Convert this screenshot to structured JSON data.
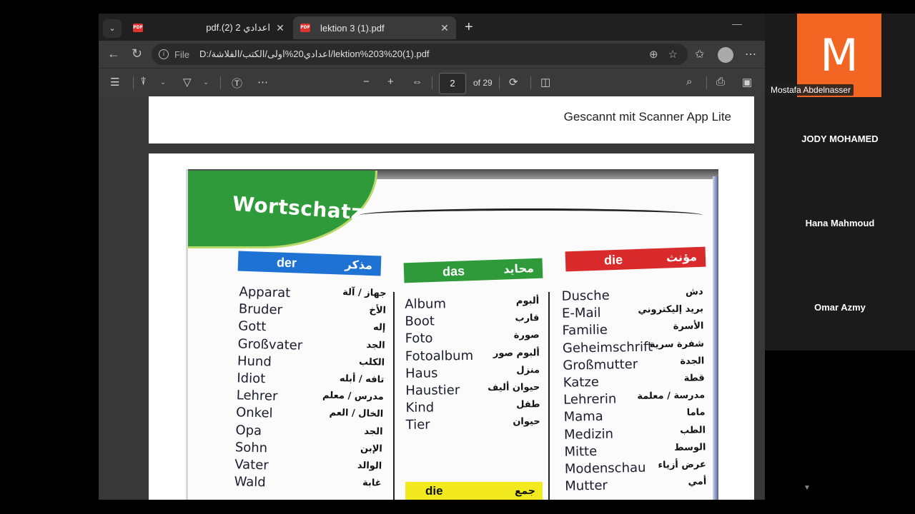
{
  "browser": {
    "tabs": [
      {
        "title": "pdf.(2) 2 اعدادي",
        "active": false
      },
      {
        "title": "lektion 3 (1).pdf",
        "active": true
      }
    ],
    "address": {
      "scheme": "File",
      "url": "D:/اعدادي20%اولى/الكتب/الفلاشة/lektion%203%20(1).pdf"
    },
    "pdf_toolbar": {
      "current_page": "2",
      "page_count": "of 29"
    }
  },
  "document": {
    "page1_stamp": "Gescannt mit Scanner App Lite",
    "page2": {
      "title": "Wortschatz",
      "columns": [
        {
          "article": "der",
          "article_ar": "مذكر",
          "color": "#1e72d4",
          "words": [
            {
              "de": "Apparat",
              "ar": "جهاز / آلة"
            },
            {
              "de": "Bruder",
              "ar": "الأخ"
            },
            {
              "de": "Gott",
              "ar": "إله"
            },
            {
              "de": "Großvater",
              "ar": "الجد"
            },
            {
              "de": "Hund",
              "ar": "الكلب"
            },
            {
              "de": "Idiot",
              "ar": "تافه / أبله"
            },
            {
              "de": "Lehrer",
              "ar": "مدرس / معلم"
            },
            {
              "de": "Onkel",
              "ar": "الخال / العم"
            },
            {
              "de": "Opa",
              "ar": "الجد"
            },
            {
              "de": "Sohn",
              "ar": "الإبن"
            },
            {
              "de": "Vater",
              "ar": "الوالد"
            },
            {
              "de": "Wald",
              "ar": "غابة"
            }
          ]
        },
        {
          "article": "das",
          "article_ar": "محايد",
          "color": "#2f9a3a",
          "words": [
            {
              "de": "Album",
              "ar": "ألبوم"
            },
            {
              "de": "Boot",
              "ar": "قارب"
            },
            {
              "de": "Foto",
              "ar": "صورة"
            },
            {
              "de": "Fotoalbum",
              "ar": "ألبوم صور"
            },
            {
              "de": "Haus",
              "ar": "منزل"
            },
            {
              "de": "Haustier",
              "ar": "حيوان أليف"
            },
            {
              "de": "Kind",
              "ar": "طفل"
            },
            {
              "de": "Tier",
              "ar": "حيوان"
            }
          ]
        },
        {
          "article": "die",
          "article_ar": "مؤنث",
          "color": "#d92b2b",
          "words": [
            {
              "de": "Dusche",
              "ar": "دش"
            },
            {
              "de": "E-Mail",
              "ar": "بريد إليكتروني"
            },
            {
              "de": "Familie",
              "ar": "الأسرة"
            },
            {
              "de": "Geheimschrift",
              "ar": "شفرة سرية"
            },
            {
              "de": "Großmutter",
              "ar": "الجدة"
            },
            {
              "de": "Katze",
              "ar": "قطة"
            },
            {
              "de": "Lehrerin",
              "ar": "مدرسة / معلمة"
            },
            {
              "de": "Mama",
              "ar": "ماما"
            },
            {
              "de": "Medizin",
              "ar": "الطب"
            },
            {
              "de": "Mitte",
              "ar": "الوسط"
            },
            {
              "de": "Modenschau",
              "ar": "عرض أزياء"
            },
            {
              "de": "Mutter",
              "ar": "أمي"
            }
          ]
        }
      ],
      "plural_header": {
        "de": "die",
        "ar": "جمع",
        "color": "#f2ea1e"
      }
    }
  },
  "meeting": {
    "main_tile": {
      "letter": "M",
      "name": "Mostafa Abdelnasser",
      "color": "#f26522"
    },
    "participants": [
      "JODY MOHAMED",
      "Hana Mahmoud",
      "Omar Azmy"
    ]
  }
}
